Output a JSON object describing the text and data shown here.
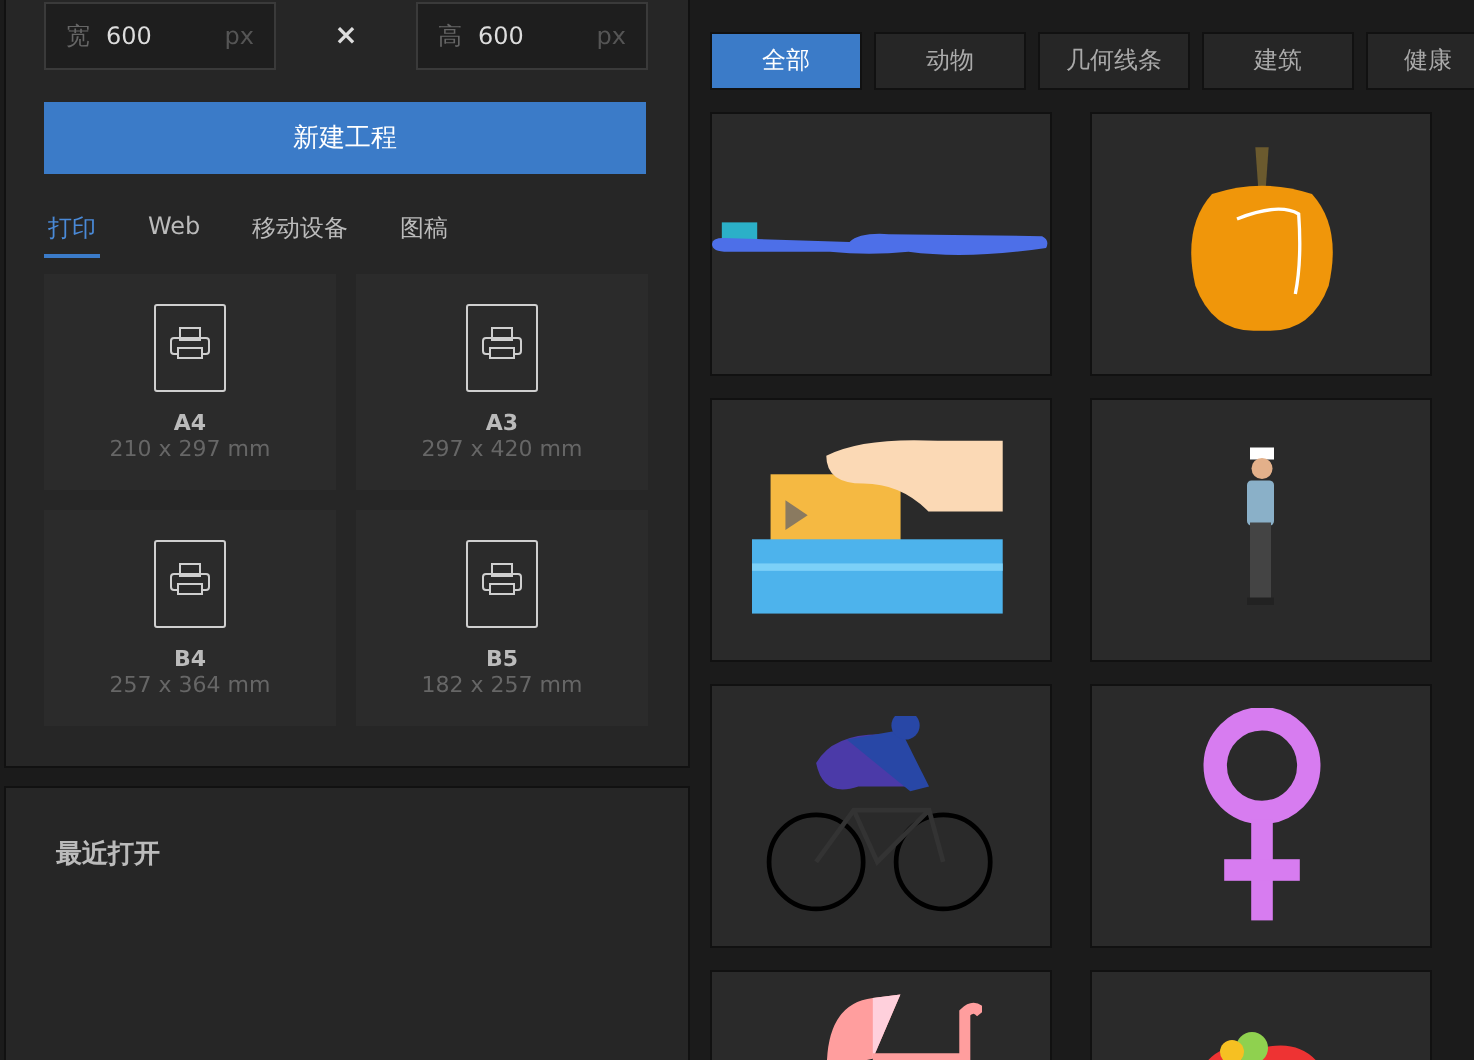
{
  "size_fields": [
    {
      "label": "宽",
      "value": "600",
      "unit": "px"
    },
    {
      "label": "高",
      "value": "600",
      "unit": "px"
    }
  ],
  "size_separator": "×",
  "create_button": "新建工程",
  "tabs": [
    {
      "label": "打印",
      "selected": true
    },
    {
      "label": "Web",
      "selected": false
    },
    {
      "label": "移动设备",
      "selected": false
    },
    {
      "label": "图稿",
      "selected": false
    }
  ],
  "presets": [
    {
      "name": "A4",
      "size": "210 x 297 mm"
    },
    {
      "name": "A3",
      "size": "297 x 420 mm"
    },
    {
      "name": "B4",
      "size": "257 x 364 mm"
    },
    {
      "name": "B5",
      "size": "182 x 257 mm"
    }
  ],
  "recent": {
    "title": "最近打开"
  },
  "categories": [
    {
      "label": "全部",
      "selected": true
    },
    {
      "label": "动物",
      "selected": false
    },
    {
      "label": "几何线条",
      "selected": false
    },
    {
      "label": "建筑",
      "selected": false
    },
    {
      "label": "健康",
      "selected": false
    }
  ],
  "tiles": [
    {
      "kind": "toothbrush"
    },
    {
      "kind": "pepper"
    },
    {
      "kind": "hand-folder"
    },
    {
      "kind": "man"
    },
    {
      "kind": "cyclist"
    },
    {
      "kind": "female-symbol"
    },
    {
      "kind": "stroller"
    },
    {
      "kind": "bouquet"
    }
  ]
}
